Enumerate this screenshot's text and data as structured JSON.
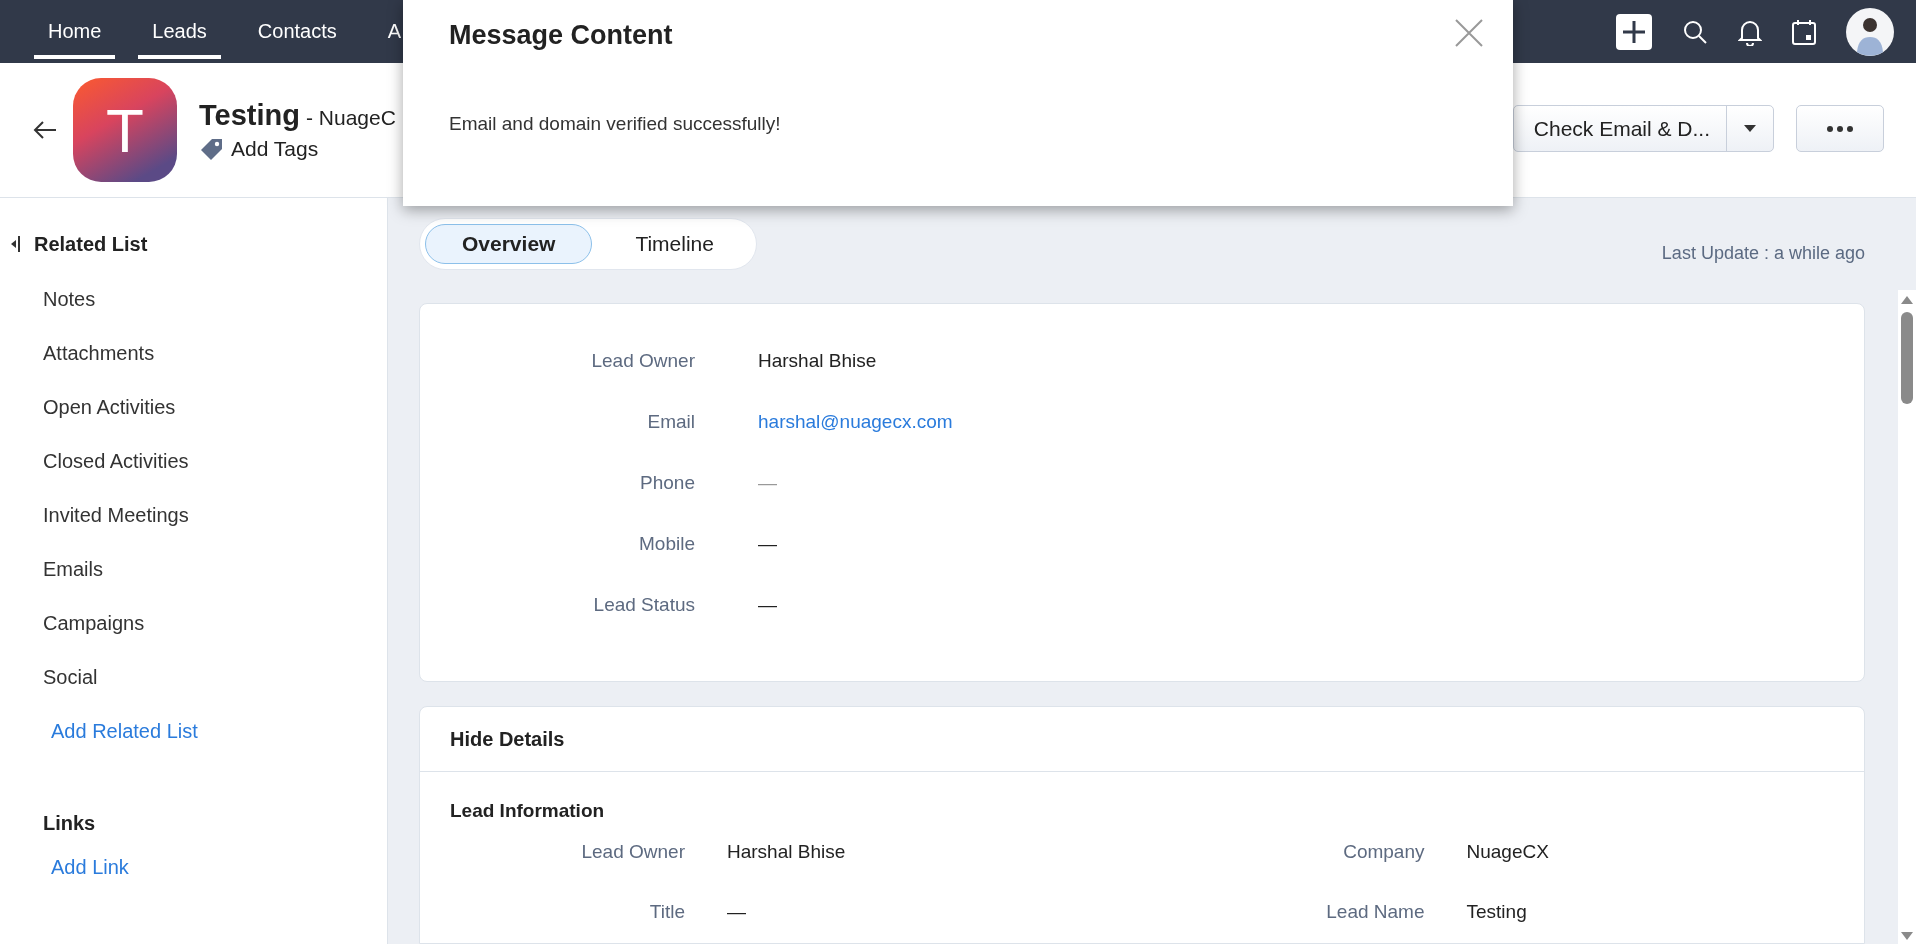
{
  "top_nav": {
    "tabs": [
      {
        "label": "Home",
        "selected": true
      },
      {
        "label": "Leads",
        "selected": true
      },
      {
        "label": "Contacts",
        "selected": false
      },
      {
        "label": "A",
        "selected": false
      }
    ]
  },
  "header": {
    "avatar_letter": "T",
    "title": "Testing",
    "subtitle": "- NuageC",
    "add_tags": "Add Tags",
    "primary_button": "Check Email & D..."
  },
  "sidebar": {
    "heading": "Related List",
    "items": [
      "Notes",
      "Attachments",
      "Open Activities",
      "Closed Activities",
      "Invited Meetings",
      "Emails",
      "Campaigns",
      "Social"
    ],
    "add_related": "Add Related List",
    "links_heading": "Links",
    "add_link": "Add Link"
  },
  "view_tabs": [
    {
      "label": "Overview",
      "selected": true
    },
    {
      "label": "Timeline",
      "selected": false
    }
  ],
  "last_update": "Last Update : a while ago",
  "summary_fields": [
    {
      "label": "Lead Owner",
      "value": "Harshal Bhise",
      "kind": "text"
    },
    {
      "label": "Email",
      "value": "harshal@nuagecx.com",
      "kind": "link"
    },
    {
      "label": "Phone",
      "value": "—",
      "kind": "empty"
    },
    {
      "label": "Mobile",
      "value": "—",
      "kind": "text"
    },
    {
      "label": "Lead Status",
      "value": "—",
      "kind": "text"
    }
  ],
  "details": {
    "toggle": "Hide Details",
    "section": "Lead Information",
    "rows": [
      {
        "left_label": "Lead Owner",
        "left_value": "Harshal Bhise",
        "right_label": "Company",
        "right_value": "NuageCX"
      },
      {
        "left_label": "Title",
        "left_value": "—",
        "right_label": "Lead Name",
        "right_value": "Testing"
      }
    ]
  },
  "modal": {
    "title": "Message Content",
    "message": "Email and domain verified successfully!"
  }
}
